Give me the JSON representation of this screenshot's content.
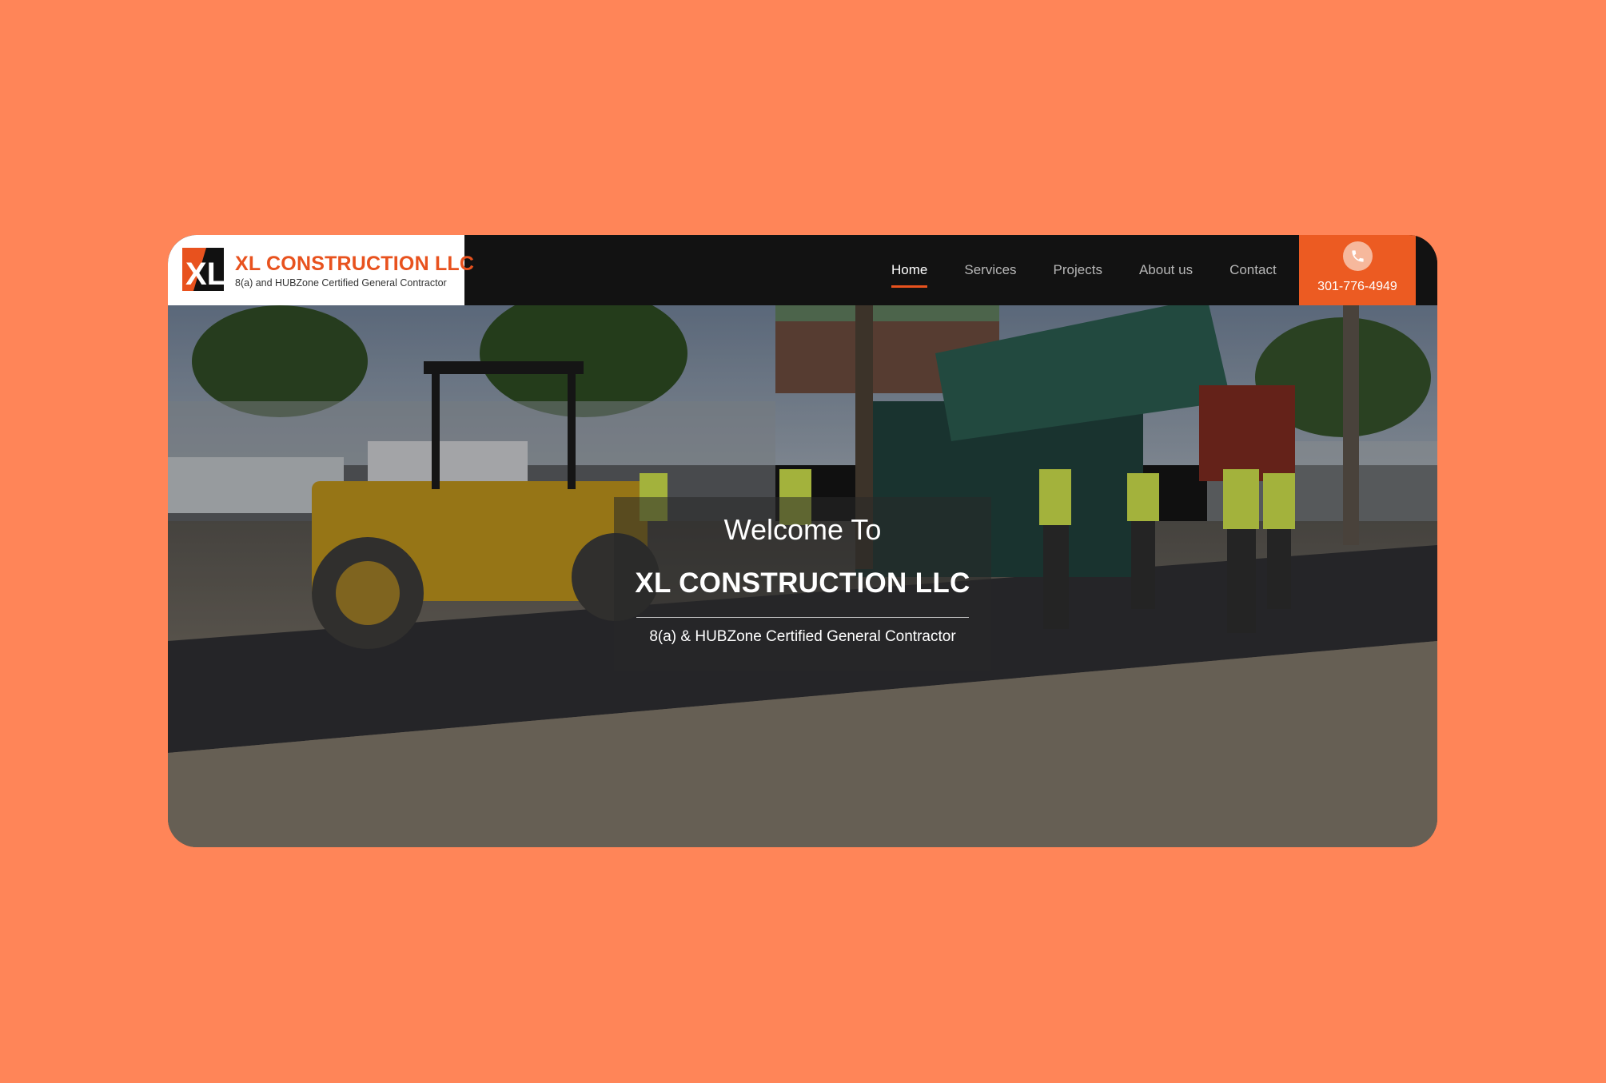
{
  "colors": {
    "background": "#FF8558",
    "accent": "#EC5B22",
    "navbar": "#121212"
  },
  "logo": {
    "title": "XL CONSTRUCTION LLC",
    "subtitle": "8(a) and HUBZone Certified General Contractor",
    "mark_text": "XL"
  },
  "nav": {
    "items": [
      {
        "label": "Home",
        "active": true
      },
      {
        "label": "Services",
        "active": false
      },
      {
        "label": "Projects",
        "active": false
      },
      {
        "label": "About us",
        "active": false
      },
      {
        "label": "Contact",
        "active": false
      }
    ]
  },
  "phone": {
    "icon": "phone-icon",
    "number": "301-776-4949"
  },
  "hero": {
    "welcome": "Welcome To",
    "title": "XL CONSTRUCTION LLC",
    "subtitle": "8(a) & HUBZone Certified General Contractor"
  }
}
